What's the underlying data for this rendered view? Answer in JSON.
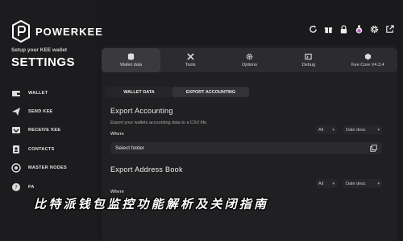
{
  "brand": {
    "name": "POWERKEE"
  },
  "sidebar": {
    "setup_line": "Setup your KEE wallet",
    "title": "SETTINGS",
    "items": [
      {
        "label": "WALLET",
        "icon": "wallet-icon"
      },
      {
        "label": "SEND KEE",
        "icon": "send-icon"
      },
      {
        "label": "RECEIVE KEE",
        "icon": "receive-icon"
      },
      {
        "label": "CONTACTS",
        "icon": "contacts-icon"
      },
      {
        "label": "MASTER NODES",
        "icon": "nodes-icon"
      },
      {
        "label": "FA",
        "icon": "faq-icon"
      }
    ]
  },
  "topbar_icons": [
    "refresh-icon",
    "gift-icon",
    "lock-icon",
    "potion-icon",
    "gear-icon",
    "external-link-icon"
  ],
  "tabs": [
    {
      "label": "Wallet data",
      "icon": "database-icon",
      "active": true
    },
    {
      "label": "Tools",
      "icon": "tools-icon",
      "active": false
    },
    {
      "label": "Options",
      "icon": "options-icon",
      "active": false
    },
    {
      "label": "Debug",
      "icon": "debug-icon",
      "active": false
    },
    {
      "label": "Kee Core V4.3.4",
      "icon": "core-icon",
      "active": false
    }
  ],
  "subtabs": [
    {
      "label": "WALLET DATA",
      "active": false
    },
    {
      "label": "EXPORT ACCOUNTING",
      "active": true
    }
  ],
  "export_accounting": {
    "title": "Export Accounting",
    "description": "Export your wallets accounting data to a CSV file.",
    "where_label": "Where",
    "filter_value": "All",
    "sort_value": "Date desc",
    "folder_label": "Select folder"
  },
  "export_address_book": {
    "title": "Export Address Book",
    "where_label": "Where",
    "filter_value": "All",
    "sort_value": "Date desc"
  },
  "overlay_title": "比特派钱包监控功能解析及关闭指南",
  "colors": {
    "background": "#1a1a1c",
    "panel": "#202022",
    "tab_bar": "#2c2c2f",
    "text": "#e8e8e8"
  }
}
